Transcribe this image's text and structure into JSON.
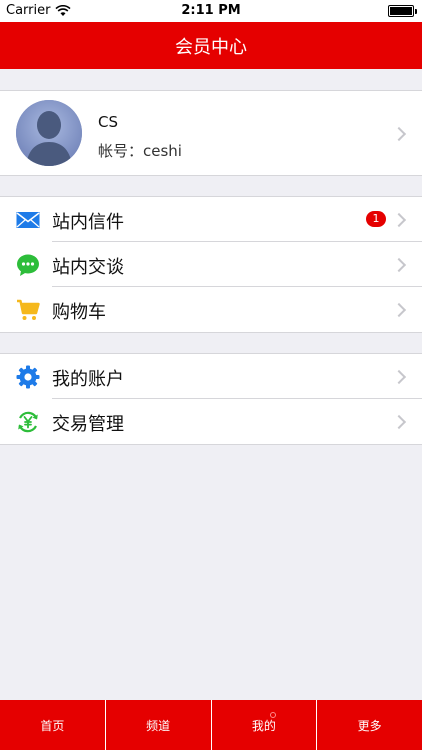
{
  "status_bar": {
    "carrier": "Carrier",
    "time": "2:11 PM"
  },
  "nav": {
    "title": "会员中心"
  },
  "profile": {
    "name": "CS",
    "account": "帐号：ceshi"
  },
  "menu_group_1": [
    {
      "label": "站内信件",
      "icon": "mail-icon",
      "badge": "1"
    },
    {
      "label": "站内交谈",
      "icon": "chat-icon"
    },
    {
      "label": "购物车",
      "icon": "cart-icon"
    }
  ],
  "menu_group_2": [
    {
      "label": "我的账户",
      "icon": "gear-icon"
    },
    {
      "label": "交易管理",
      "icon": "yen-cycle-icon"
    }
  ],
  "tabs": [
    {
      "label": "首页"
    },
    {
      "label": "频道"
    },
    {
      "label": "我的"
    },
    {
      "label": "更多"
    }
  ],
  "colors": {
    "brand_red": "#e50000",
    "background": "#efeff4",
    "mail_blue": "#1e7be8",
    "chat_green": "#2dbd3a",
    "cart_yellow": "#f5b81c",
    "gear_blue": "#1e7be8",
    "trade_green": "#2dbd3a"
  }
}
